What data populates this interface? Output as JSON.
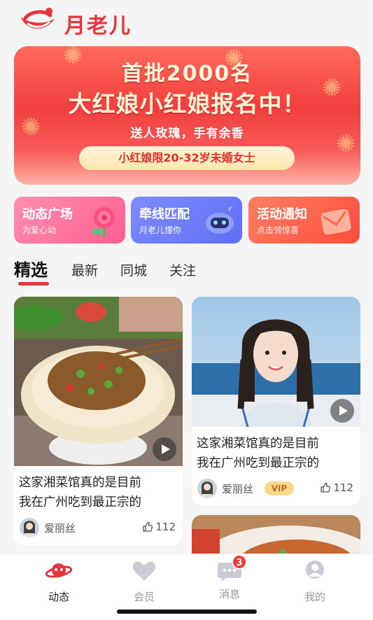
{
  "app": {
    "name": "月老儿"
  },
  "banner": {
    "line1": "首批2000名",
    "line2": "大红娘小红娘报名中！",
    "line3": "送人玫瑰，手有余香",
    "pill": "小红娘限20-32岁未婚女士"
  },
  "features": [
    {
      "title": "动态广场",
      "subtitle": "为爱心动",
      "icon": "rose-icon"
    },
    {
      "title": "牵线匹配",
      "subtitle": "月老儿懂你",
      "icon": "robot-icon"
    },
    {
      "title": "活动通知",
      "subtitle": "点击领惊喜",
      "icon": "envelope-icon"
    }
  ],
  "tabs": [
    "精选",
    "最新",
    "同城",
    "关注"
  ],
  "cards": [
    {
      "title_line1": "这家湘菜馆真的是目前",
      "title_line2": "我在广州吃到最正宗的",
      "user": "爱丽丝",
      "likes": "112",
      "vip": ""
    },
    {
      "title_line1": "这家湘菜馆真的是目前",
      "title_line2": "我在广州吃到最正宗的",
      "user": "爱丽丝",
      "likes": "112",
      "vip": "VIP"
    }
  ],
  "nav": [
    {
      "label": "动态",
      "icon": "planet-icon",
      "active": true
    },
    {
      "label": "会员",
      "icon": "heart-icon"
    },
    {
      "label": "消息",
      "icon": "chat-icon",
      "badge": "3"
    },
    {
      "label": "我的",
      "icon": "user-icon"
    }
  ],
  "colors": {
    "brand": "#e8353b",
    "vip": "#fbd88a"
  }
}
